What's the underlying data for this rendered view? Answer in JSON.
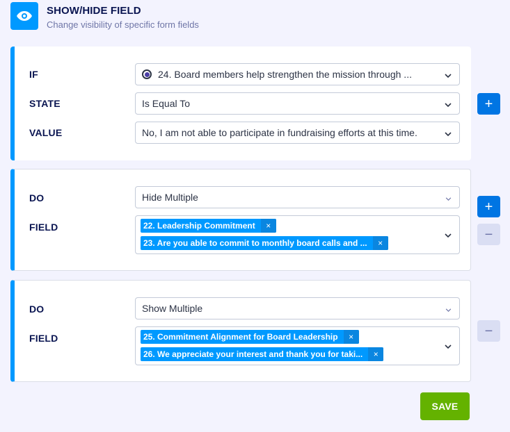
{
  "header": {
    "title": "SHOW/HIDE FIELD",
    "subtitle": "Change visibility of specific form fields",
    "icon": "eye-icon"
  },
  "condition": {
    "if_label": "IF",
    "if_value": "24. Board members help strengthen the mission through ...",
    "state_label": "STATE",
    "state_value": "Is Equal To",
    "value_label": "VALUE",
    "value_value": "No, I am not able to participate in fundraising efforts at this time."
  },
  "actions": [
    {
      "do_label": "DO",
      "do_value": "Hide Multiple",
      "field_label": "FIELD",
      "tags": [
        "22. Leadership Commitment",
        "23. Are you able to commit to monthly board calls and ..."
      ]
    },
    {
      "do_label": "DO",
      "do_value": "Show Multiple",
      "field_label": "FIELD",
      "tags": [
        "25. Commitment Alignment for Board Leadership",
        "26. We appreciate your interest and thank you for taki..."
      ]
    }
  ],
  "buttons": {
    "add": "+",
    "remove": "−",
    "tag_remove": "×",
    "save": "SAVE"
  },
  "colors": {
    "accent": "#0099ff",
    "add_button": "#0075e3",
    "save_button": "#64b200",
    "background": "#f3f3fe"
  }
}
